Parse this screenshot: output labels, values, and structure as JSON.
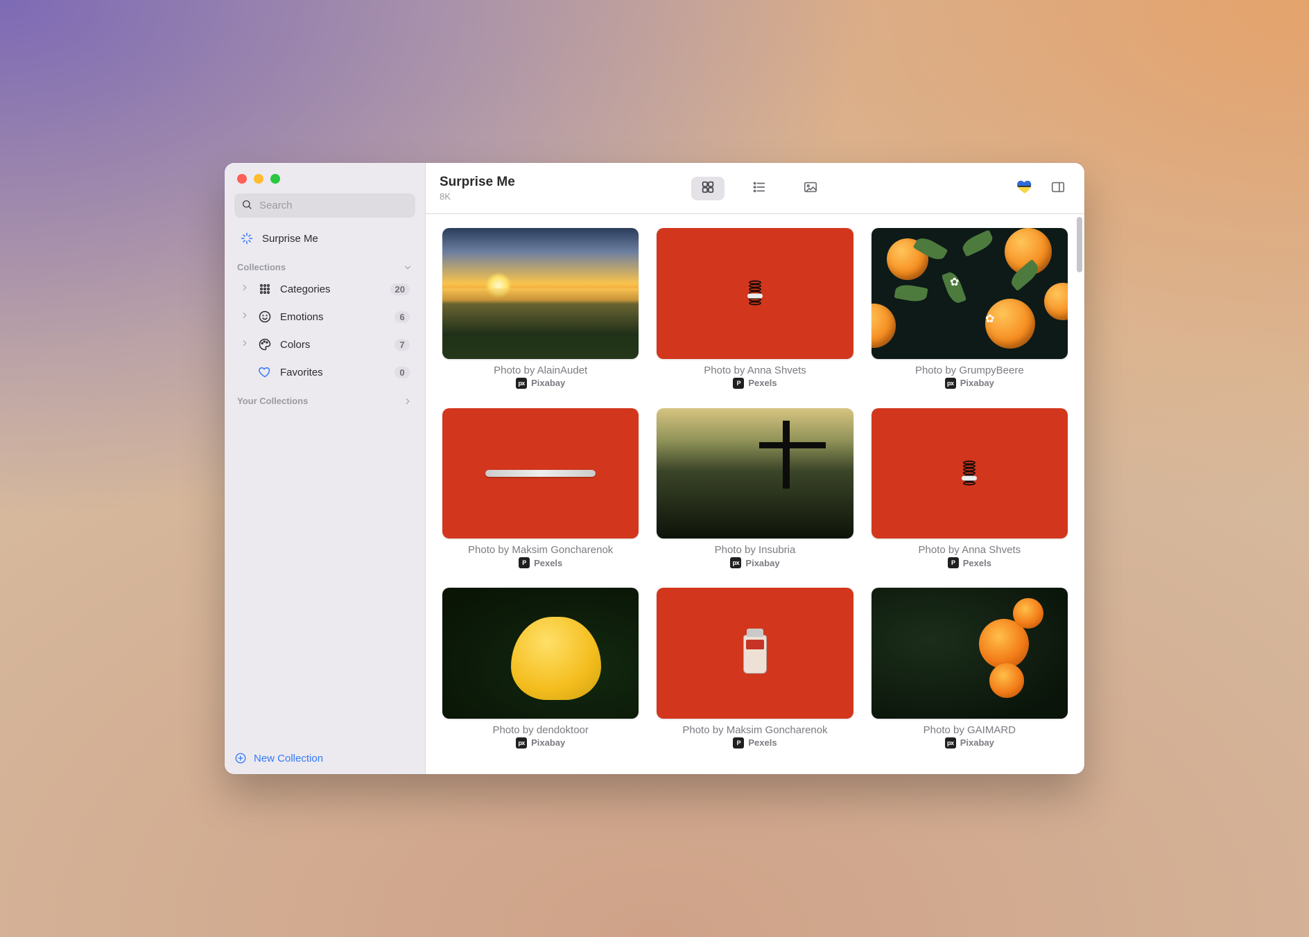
{
  "window": {
    "title": "Surprise Me",
    "subtitle": "8K"
  },
  "search": {
    "placeholder": "Search"
  },
  "sidebar": {
    "surprise_label": "Surprise Me",
    "sections": {
      "collections_label": "Collections",
      "your_collections_label": "Your Collections"
    },
    "items": [
      {
        "label": "Categories",
        "count": "20"
      },
      {
        "label": "Emotions",
        "count": "6"
      },
      {
        "label": "Colors",
        "count": "7"
      },
      {
        "label": "Favorites",
        "count": "0"
      }
    ],
    "new_collection_label": "New Collection"
  },
  "toolbar": {
    "view_grid_label": "Grid view",
    "view_list_label": "List view",
    "view_image_label": "Image view",
    "heart_emoji": "💙💛",
    "sidebar_toggle_label": "Toggle sidebar"
  },
  "sources": {
    "pixabay": "Pixabay",
    "pexels": "Pexels"
  },
  "photos": [
    {
      "caption": "Photo by AlainAudet",
      "source": "pixabay",
      "thumb": "sunset"
    },
    {
      "caption": "Photo by Anna Shvets",
      "source": "pexels",
      "thumb": "orange-coil-h"
    },
    {
      "caption": "Photo by GrumpyBeere",
      "source": "pixabay",
      "thumb": "oranges"
    },
    {
      "caption": "Photo by Maksim Goncharenok",
      "source": "pexels",
      "thumb": "thermo"
    },
    {
      "caption": "Photo by Insubria",
      "source": "pixabay",
      "thumb": "cross"
    },
    {
      "caption": "Photo by Anna Shvets",
      "source": "pexels",
      "thumb": "orange-coil-v"
    },
    {
      "caption": "Photo by dendoktoor",
      "source": "pixabay",
      "thumb": "tulip"
    },
    {
      "caption": "Photo by Maksim Goncharenok",
      "source": "pexels",
      "thumb": "vial"
    },
    {
      "caption": "Photo by GAIMARD",
      "source": "pixabay",
      "thumb": "roses"
    }
  ]
}
